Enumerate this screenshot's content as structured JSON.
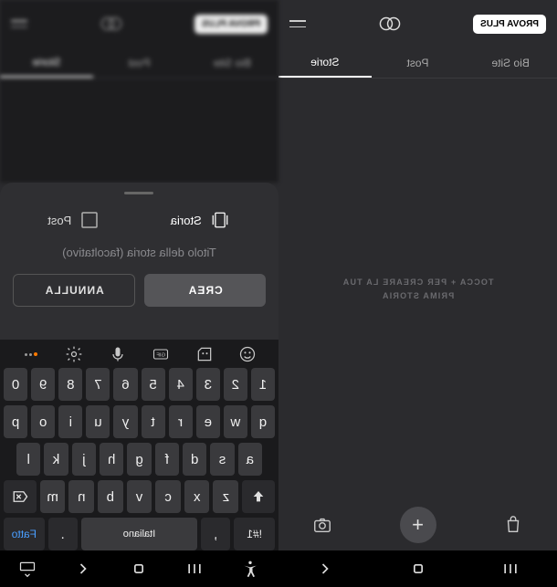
{
  "header": {
    "badge": "PROVA PLUS"
  },
  "tabs": {
    "items": [
      {
        "label": "Bio Site"
      },
      {
        "label": "Post"
      },
      {
        "label": "Storie",
        "active": true
      }
    ]
  },
  "placeholder": {
    "line1": "TOCCA + PER CREARE LA TUA",
    "line2": "PRIMA STORIA"
  },
  "modal": {
    "types": [
      {
        "label": "Storia",
        "selected": true
      },
      {
        "label": "Post"
      }
    ],
    "title_placeholder": "Titolo della storia (facoltativo)",
    "create": "CREA",
    "cancel": "ANNULLA"
  },
  "keyboard": {
    "row1": [
      "1",
      "2",
      "3",
      "4",
      "5",
      "6",
      "7",
      "8",
      "9",
      "0"
    ],
    "row2": [
      "q",
      "w",
      "e",
      "r",
      "t",
      "y",
      "u",
      "i",
      "o",
      "p"
    ],
    "row3": [
      "a",
      "s",
      "d",
      "f",
      "g",
      "h",
      "j",
      "k",
      "l"
    ],
    "row4": [
      "z",
      "x",
      "c",
      "v",
      "b",
      "n",
      "m"
    ],
    "sym": "!#1",
    "lang": "Italiano",
    "done": "Fatto"
  }
}
